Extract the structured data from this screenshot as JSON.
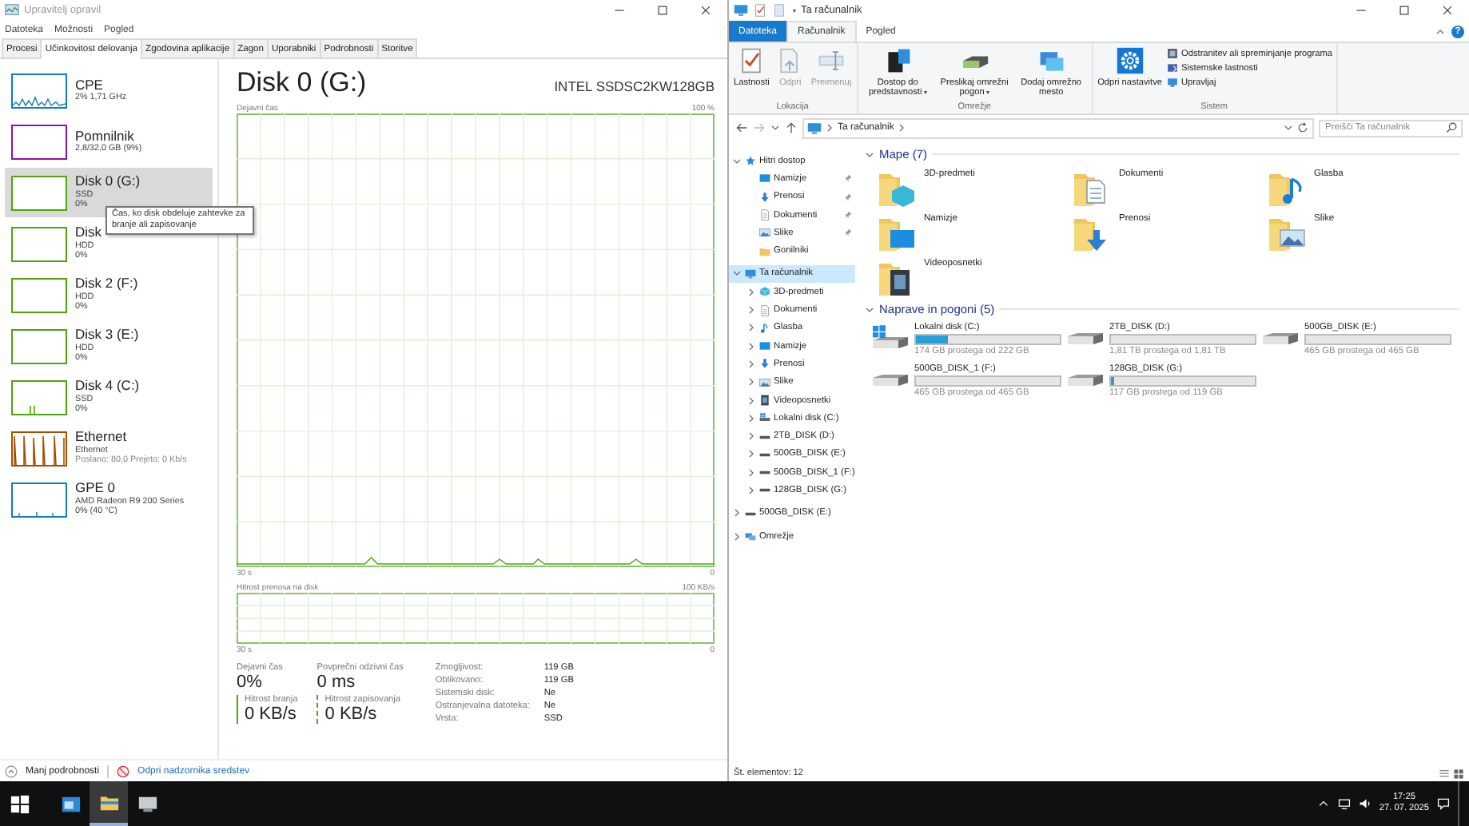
{
  "task_manager": {
    "window": {
      "title": "Upravitelj opravil"
    },
    "menu": [
      "Datoteka",
      "Možnosti",
      "Pogled"
    ],
    "tabs": [
      {
        "label": "Procesi",
        "selected": false
      },
      {
        "label": "Učinkovitost delovanja",
        "selected": true
      },
      {
        "label": "Zgodovina aplikacije",
        "selected": false
      },
      {
        "label": "Zagon",
        "selected": false
      },
      {
        "label": "Uporabniki",
        "selected": false
      },
      {
        "label": "Podrobnosti",
        "selected": false
      },
      {
        "label": "Storitve",
        "selected": false
      }
    ],
    "resources": [
      {
        "name": "CPE",
        "line1": "2% 1,71 GHz",
        "kind": "cpu",
        "selected": false
      },
      {
        "name": "Pomnilnik",
        "line1": "2,8/32,0 GB (9%)",
        "kind": "memory",
        "selected": false
      },
      {
        "name": "Disk 0 (G:)",
        "line1": "SSD",
        "line2": "0%",
        "kind": "disk",
        "selected": true
      },
      {
        "name": "Disk",
        "line1": "HDD",
        "line2": "0%",
        "kind": "disk",
        "selected": false
      },
      {
        "name": "Disk 2 (F:)",
        "line1": "HDD",
        "line2": "0%",
        "kind": "disk",
        "selected": false
      },
      {
        "name": "Disk 3 (E:)",
        "line1": "HDD",
        "line2": "0%",
        "kind": "disk",
        "selected": false
      },
      {
        "name": "Disk 4 (C:)",
        "line1": "SSD",
        "line2": "0%",
        "kind": "diskactive",
        "selected": false
      },
      {
        "name": "Ethernet",
        "line1": "Ethernet",
        "line2": "Poslano: 80,0 Prejeto: 0 Kb/s",
        "kind": "network",
        "selected": false
      },
      {
        "name": "GPE 0",
        "line1": "AMD Radeon R9 200 Series",
        "line2": "0% (40 °C)",
        "kind": "gpu",
        "selected": false
      }
    ],
    "tooltip": "Čas, ko disk obdeluje zahtevke za branje ali zapisovanje",
    "detail": {
      "title": "Disk 0 (G:)",
      "model": "INTEL SSDSC2KW128GB",
      "graph1": {
        "label": "Dejavni čas",
        "max": "100 %",
        "time": "30 s",
        "min": "0"
      },
      "graph2": {
        "label": "Hitrost prenosa na disk",
        "max": "100 KB/s",
        "time": "30 s",
        "min": "0"
      },
      "stats": [
        {
          "label": "Dejavni čas",
          "value": "0%"
        },
        {
          "label": "Povprečni odzivni čas",
          "value": "0 ms"
        },
        {
          "label": "Hitrost branja",
          "value": "0 KB/s"
        },
        {
          "label": "Hitrost zapisovanja",
          "value": "0 KB/s"
        }
      ],
      "properties": [
        {
          "label": "Zmogljivost:",
          "value": "119 GB"
        },
        {
          "label": "Oblikovano:",
          "value": "119 GB"
        },
        {
          "label": "Sistemski disk:",
          "value": "Ne"
        },
        {
          "label": "Ostranjevalna datoteka:",
          "value": "Ne"
        },
        {
          "label": "Vrsta:",
          "value": "SSD"
        }
      ]
    },
    "footer": {
      "less": "Manj podrobnosti",
      "monitor": "Odpri nadzornika sredstev"
    }
  },
  "explorer": {
    "window": {
      "title": "Ta računalnik"
    },
    "ribbon": {
      "tabs": [
        {
          "label": "Datoteka",
          "kind": "file",
          "selected": false
        },
        {
          "label": "Računalnik",
          "kind": "tab",
          "selected": true
        },
        {
          "label": "Pogled",
          "kind": "tab",
          "selected": false
        }
      ],
      "help": "?",
      "groups": [
        {
          "label": "Lokacija",
          "buttons": [
            {
              "label": "Lastnosti",
              "kind": "properties",
              "dropdown": false,
              "disabled": false
            },
            {
              "label": "Odpri",
              "kind": "open",
              "dropdown": false,
              "disabled": true
            },
            {
              "label": "Preimenuj",
              "kind": "rename",
              "dropdown": false,
              "disabled": true
            }
          ]
        },
        {
          "label": "Omrežje",
          "buttons": [
            {
              "label": "Dostop do predstavnosti",
              "kind": "media",
              "dropdown": true,
              "disabled": false
            },
            {
              "label": "Preslikaj omrežni pogon",
              "kind": "mapdrive",
              "dropdown": true,
              "disabled": false
            },
            {
              "label": "Dodaj omrežno mesto",
              "kind": "location",
              "dropdown": false,
              "disabled": false
            }
          ]
        },
        {
          "label": "Sistem",
          "buttons": [
            {
              "label": "Odpri nastavitve",
              "kind": "settings",
              "dropdown": false,
              "disabled": false
            }
          ],
          "small_buttons": [
            {
              "label": "Odstranitev ali spreminjanje programa",
              "kind": "uninstall"
            },
            {
              "label": "Sistemske lastnosti",
              "kind": "system"
            },
            {
              "label": "Upravljaj",
              "kind": "manage"
            }
          ]
        }
      ]
    },
    "address": {
      "path": "Ta računalnik",
      "search_placeholder": "Preišči Ta računalnik"
    },
    "nav_tree": [
      {
        "label": "Hitri dostop",
        "kind": "quick",
        "expanded": true,
        "selected": false,
        "children": [
          {
            "label": "Namizje",
            "kind": "desktop",
            "pinned": true,
            "selected": false
          },
          {
            "label": "Prenosi",
            "kind": "download",
            "pinned": true,
            "selected": false
          },
          {
            "label": "Dokumenti",
            "kind": "documents",
            "pinned": true,
            "selected": false
          },
          {
            "label": "Slike",
            "kind": "pictures",
            "pinned": true,
            "selected": false
          },
          {
            "label": "Gonilniki",
            "kind": "folder",
            "pinned": false,
            "selected": false
          }
        ]
      },
      {
        "label": "Ta računalnik",
        "kind": "pc",
        "expanded": true,
        "selected": true,
        "children": [
          {
            "label": "3D-predmeti",
            "kind": "objects",
            "expanded": false,
            "selected": false
          },
          {
            "label": "Dokumenti",
            "kind": "documents",
            "expanded": false,
            "selected": false
          },
          {
            "label": "Glasba",
            "kind": "music",
            "expanded": false,
            "selected": false
          },
          {
            "label": "Namizje",
            "kind": "desktop",
            "expanded": false,
            "selected": false
          },
          {
            "label": "Prenosi",
            "kind": "download",
            "expanded": false,
            "selected": false
          },
          {
            "label": "Slike",
            "kind": "pictures",
            "expanded": false,
            "selected": false
          },
          {
            "label": "Videoposnetki",
            "kind": "video",
            "expanded": false,
            "selected": false
          },
          {
            "label": "Lokalni disk (C:)",
            "kind": "systemdrive",
            "expanded": false,
            "selected": false
          },
          {
            "label": "2TB_DISK (D:)",
            "kind": "drive",
            "expanded": false,
            "selected": false
          },
          {
            "label": "500GB_DISK (E:)",
            "kind": "drive",
            "expanded": false,
            "selected": false
          },
          {
            "label": "500GB_DISK_1 (F:)",
            "kind": "drive",
            "expanded": false,
            "selected": false
          },
          {
            "label": "128GB_DISK (G:)",
            "kind": "drive",
            "expanded": false,
            "selected": false
          }
        ]
      },
      {
        "label": "500GB_DISK (E:)",
        "kind": "drive",
        "expanded": false,
        "selected": false
      },
      {
        "label": "Omrežje",
        "kind": "network",
        "expanded": false,
        "selected": false
      }
    ],
    "sections": [
      {
        "title": "Mape (7)",
        "kind": "folders",
        "expanded": true,
        "items": [
          {
            "label": "3D-predmeti",
            "kind": "objects"
          },
          {
            "label": "Dokumenti",
            "kind": "documents"
          },
          {
            "label": "Glasba",
            "kind": "music"
          },
          {
            "label": "Namizje",
            "kind": "desktop"
          },
          {
            "label": "Prenosi",
            "kind": "download"
          },
          {
            "label": "Slike",
            "kind": "pictures"
          },
          {
            "label": "Videoposnetki",
            "kind": "video"
          }
        ]
      },
      {
        "title": "Naprave in pogoni (5)",
        "kind": "drives",
        "expanded": true,
        "items": [
          {
            "label": "Lokalni disk (C:)",
            "kind": "systemdrive",
            "level": 0.22,
            "free": "174 GB prostega od 222 GB"
          },
          {
            "label": "2TB_DISK (D:)",
            "kind": "drive",
            "level": 0,
            "free": "1,81 TB prostega od 1,81 TB"
          },
          {
            "label": "500GB_DISK (E:)",
            "kind": "drive",
            "level": 0,
            "free": "465 GB prostega od 465 GB"
          },
          {
            "label": "500GB_DISK_1 (F:)",
            "kind": "drive",
            "level": 0,
            "free": "465 GB prostega od 465 GB"
          },
          {
            "label": "128GB_DISK (G:)",
            "kind": "drive",
            "level": 0.02,
            "free": "117 GB prostega od 119 GB"
          }
        ]
      }
    ],
    "status": "Št. elementov: 12"
  },
  "taskbar": {
    "apps": [
      {
        "kind": "server",
        "selected": false
      },
      {
        "kind": "explorer",
        "selected": true
      },
      {
        "kind": "taskmgr",
        "selected": false
      }
    ],
    "time": "17:25",
    "date": "27. 07. 2025"
  }
}
